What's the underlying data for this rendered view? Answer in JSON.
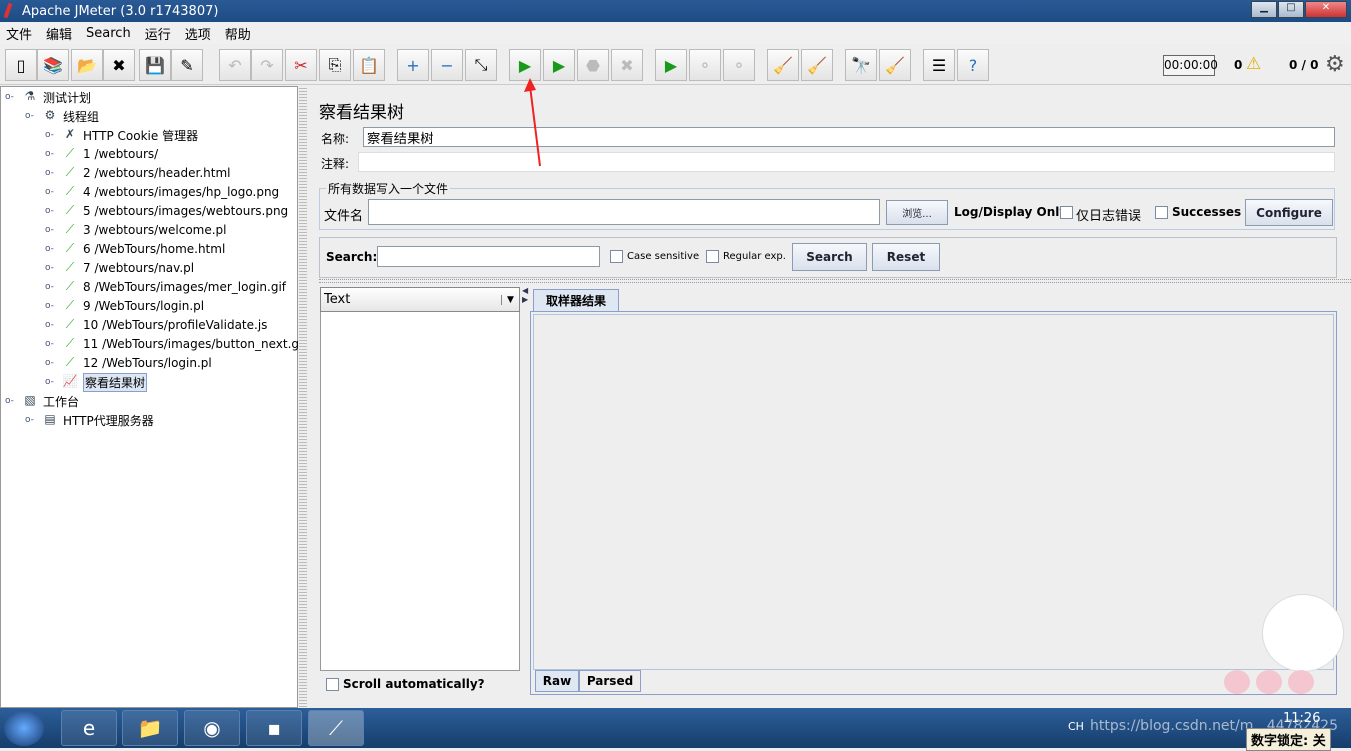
{
  "window": {
    "title": "Apache JMeter (3.0 r1743807)",
    "minimize": "▁",
    "maximize": "□",
    "close": "✕"
  },
  "menu": [
    "文件",
    "编辑",
    "Search",
    "运行",
    "选项",
    "帮助"
  ],
  "toolbar": {
    "buttons": [
      {
        "name": "new-icon",
        "glyph": "▯"
      },
      {
        "name": "templates-icon",
        "glyph": "📚"
      },
      {
        "name": "open-icon",
        "glyph": "📂"
      },
      {
        "name": "close-icon",
        "glyph": "✖"
      },
      {
        "name": "save-icon",
        "glyph": "💾"
      },
      {
        "name": "save-as-icon",
        "glyph": "✎"
      },
      {
        "name": "undo-icon",
        "glyph": "↶",
        "disabled": true
      },
      {
        "name": "redo-icon",
        "glyph": "↷",
        "disabled": true
      },
      {
        "name": "cut-icon",
        "glyph": "✂"
      },
      {
        "name": "copy-icon",
        "glyph": "⎘"
      },
      {
        "name": "paste-icon",
        "glyph": "📋"
      },
      {
        "name": "expand-icon",
        "glyph": "+"
      },
      {
        "name": "collapse-icon",
        "glyph": "−"
      },
      {
        "name": "toggle-icon",
        "glyph": "⤡"
      },
      {
        "name": "start-icon",
        "glyph": "▶"
      },
      {
        "name": "start-no-pause-icon",
        "glyph": "▶"
      },
      {
        "name": "stop-icon",
        "glyph": "⬣",
        "disabled": true
      },
      {
        "name": "shutdown-icon",
        "glyph": "✖",
        "disabled": true
      },
      {
        "name": "remote-start-icon",
        "glyph": "▶"
      },
      {
        "name": "remote-stop-icon",
        "glyph": "⚬",
        "disabled": true
      },
      {
        "name": "remote-shutdown-icon",
        "glyph": "⚬",
        "disabled": true
      },
      {
        "name": "clear-icon",
        "glyph": "🧹"
      },
      {
        "name": "clear-all-icon",
        "glyph": "🧹"
      },
      {
        "name": "search-binoculars-icon",
        "glyph": "🔭"
      },
      {
        "name": "reset-search-icon",
        "glyph": "🧹"
      },
      {
        "name": "function-helper-icon",
        "glyph": "☰"
      },
      {
        "name": "help-icon",
        "glyph": "?"
      }
    ],
    "timer": "00:00:00",
    "warnings": "0",
    "threads": "0 / 0"
  },
  "tree": [
    {
      "label": "测试计划",
      "level": 0,
      "icon": "flask-icon",
      "glyph": "⚗"
    },
    {
      "label": "线程组",
      "level": 1,
      "icon": "gear-icon",
      "glyph": "⚙"
    },
    {
      "label": "HTTP Cookie 管理器",
      "level": 2,
      "icon": "wrench-icon",
      "glyph": "✗"
    },
    {
      "label": "1 /webtours/",
      "level": 2,
      "icon": "sampler-pipette-icon",
      "glyph": "⟋"
    },
    {
      "label": "2 /webtours/header.html",
      "level": 2,
      "icon": "sampler-pipette-icon",
      "glyph": "⟋"
    },
    {
      "label": "4 /webtours/images/hp_logo.png",
      "level": 2,
      "icon": "sampler-pipette-icon",
      "glyph": "⟋"
    },
    {
      "label": "5 /webtours/images/webtours.png",
      "level": 2,
      "icon": "sampler-pipette-icon",
      "glyph": "⟋"
    },
    {
      "label": "3 /webtours/welcome.pl",
      "level": 2,
      "icon": "sampler-pipette-icon",
      "glyph": "⟋"
    },
    {
      "label": "6 /WebTours/home.html",
      "level": 2,
      "icon": "sampler-pipette-icon",
      "glyph": "⟋"
    },
    {
      "label": "7 /webtours/nav.pl",
      "level": 2,
      "icon": "sampler-pipette-icon",
      "glyph": "⟋"
    },
    {
      "label": "8 /WebTours/images/mer_login.gif",
      "level": 2,
      "icon": "sampler-pipette-icon",
      "glyph": "⟋"
    },
    {
      "label": "9 /WebTours/login.pl",
      "level": 2,
      "icon": "sampler-pipette-icon",
      "glyph": "⟋"
    },
    {
      "label": "10 /WebTours/profileValidate.js",
      "level": 2,
      "icon": "sampler-pipette-icon",
      "glyph": "⟋"
    },
    {
      "label": "11 /WebTours/images/button_next.gif",
      "level": 2,
      "icon": "sampler-pipette-icon",
      "glyph": "⟋"
    },
    {
      "label": "12 /WebTours/login.pl",
      "level": 2,
      "icon": "sampler-pipette-icon",
      "glyph": "⟋"
    },
    {
      "label": "察看结果树",
      "level": 2,
      "icon": "listener-chart-icon",
      "glyph": "📈",
      "selected": true
    },
    {
      "label": "工作台",
      "level": 0,
      "icon": "workbench-icon",
      "glyph": "▧"
    },
    {
      "label": "HTTP代理服务器",
      "level": 1,
      "icon": "proxy-icon",
      "glyph": "▤"
    }
  ],
  "panel": {
    "title": "察看结果树",
    "name_label": "名称:",
    "name_value": "察看结果树",
    "comment_label": "注释:",
    "comment_value": "",
    "file_group": "所有数据写入一个文件",
    "filename_label": "文件名",
    "filename_value": "",
    "browse": "浏览...",
    "log_display": "Log/Display Only:",
    "errors_only": "仅日志错误",
    "successes": "Successes",
    "configure": "Configure",
    "search_label": "Search:",
    "search_value": "",
    "case_sensitive": "Case sensitive",
    "regex": "Regular exp.",
    "search_btn": "Search",
    "reset_btn": "Reset",
    "renderer": "Text",
    "result_tab": "取样器结果",
    "scroll_auto": "Scroll automatically?",
    "raw_tab": "Raw",
    "parsed_tab": "Parsed"
  },
  "taskbar": {
    "lang": "CH",
    "clock": "11:26",
    "numlock": "数字锁定: 关",
    "watermark": "https://blog.csdn.net/m...44782425"
  },
  "accent": "#1d4b84"
}
